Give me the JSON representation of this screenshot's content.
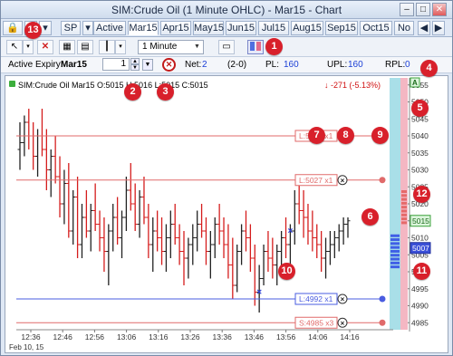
{
  "window": {
    "title": "SIM:Crude Oil (1 Minute OHLC) - Mar15 - Chart",
    "min": "–",
    "max": "□",
    "close": "✕"
  },
  "tabs": {
    "items": [
      {
        "label": "SP",
        "selected": false
      },
      {
        "label": "Active",
        "selected": false
      },
      {
        "label": "Mar15",
        "selected": true
      },
      {
        "label": "Apr15",
        "selected": false
      },
      {
        "label": "May15",
        "selected": false
      },
      {
        "label": "Jun15",
        "selected": false
      },
      {
        "label": "Jul15",
        "selected": false
      },
      {
        "label": "Aug15",
        "selected": false
      },
      {
        "label": "Sep15",
        "selected": false
      },
      {
        "label": "Oct15",
        "selected": false
      },
      {
        "label": "No",
        "selected": false
      }
    ]
  },
  "toolbar": {
    "interval": "1 Minute"
  },
  "info": {
    "expiry_label": "Active Expiry:",
    "expiry_value": "Mar15",
    "qty": "1",
    "net_label": "Net:",
    "net_value": "2",
    "pos_value": "(2-0)",
    "pl_label": "PL:",
    "pl_value": "160",
    "upl_label": "UPL:",
    "upl_value": "160",
    "rpl_label": "RPL:",
    "rpl_value": "0"
  },
  "chart_header": {
    "text": "SIM:Crude Oil Mar15 O:5015 H:5016 L:5015 C:5015",
    "change": "-271 (-5.13%)"
  },
  "chart_data": {
    "type": "bar",
    "title": "SIM:Crude Oil Mar15",
    "x_ticks": [
      "12:36",
      "12:46",
      "12:56",
      "13:06",
      "13:16",
      "13:26",
      "13:36",
      "13:46",
      "13:56",
      "14:06",
      "14:16"
    ],
    "x_start_label": "Feb 10, 15",
    "y_ticks": [
      4985,
      4990,
      4995,
      5000,
      5005,
      5010,
      5015,
      5020,
      5025,
      5030,
      5035,
      5040,
      5045,
      5050,
      5055
    ],
    "ylim": [
      4984,
      5056
    ],
    "current_price": 5015,
    "ask_tag": 5015,
    "bid_tag": 5007,
    "bars_ohlc": [
      [
        5036,
        5044,
        5030,
        5038
      ],
      [
        5038,
        5046,
        5034,
        5044
      ],
      [
        5044,
        5048,
        5036,
        5040
      ],
      [
        5040,
        5044,
        5030,
        5034
      ],
      [
        5034,
        5042,
        5028,
        5040
      ],
      [
        5040,
        5048,
        5034,
        5036
      ],
      [
        5036,
        5042,
        5024,
        5030
      ],
      [
        5030,
        5036,
        5022,
        5034
      ],
      [
        5034,
        5040,
        5026,
        5028
      ],
      [
        5028,
        5034,
        5016,
        5020
      ],
      [
        5020,
        5030,
        5014,
        5026
      ],
      [
        5026,
        5032,
        5010,
        5012
      ],
      [
        5012,
        5024,
        5008,
        5022
      ],
      [
        5022,
        5028,
        5004,
        5008
      ],
      [
        5008,
        5020,
        5004,
        5016
      ],
      [
        5016,
        5024,
        5010,
        5012
      ],
      [
        5012,
        5020,
        5006,
        5018
      ],
      [
        5018,
        5026,
        5012,
        5014
      ],
      [
        5014,
        5018,
        5006,
        5010
      ],
      [
        5010,
        5016,
        5000,
        5006
      ],
      [
        5006,
        5014,
        4996,
        5012
      ],
      [
        5012,
        5020,
        5006,
        5016
      ],
      [
        5016,
        5022,
        5008,
        5010
      ],
      [
        5010,
        5018,
        5004,
        5016
      ],
      [
        5016,
        5028,
        5012,
        5024
      ],
      [
        5024,
        5032,
        5018,
        5020
      ],
      [
        5020,
        5026,
        5012,
        5014
      ],
      [
        5014,
        5024,
        5010,
        5022
      ],
      [
        5022,
        5028,
        5014,
        5016
      ],
      [
        5016,
        5020,
        5004,
        5008
      ],
      [
        5008,
        5016,
        5000,
        5012
      ],
      [
        5012,
        5018,
        5006,
        5010
      ],
      [
        5010,
        5016,
        5002,
        5006
      ],
      [
        5006,
        5014,
        5000,
        5010
      ],
      [
        5010,
        5018,
        5004,
        5014
      ],
      [
        5014,
        5020,
        5008,
        5010
      ],
      [
        5010,
        5014,
        5002,
        5006
      ],
      [
        5006,
        5012,
        4996,
        5004
      ],
      [
        5004,
        5010,
        4998,
        5008
      ],
      [
        5008,
        5014,
        5002,
        5010
      ],
      [
        5010,
        5018,
        5006,
        5014
      ],
      [
        5014,
        5020,
        5010,
        5012
      ],
      [
        5012,
        5016,
        5002,
        5006
      ],
      [
        5006,
        5012,
        4998,
        5008
      ],
      [
        5008,
        5016,
        5004,
        5014
      ],
      [
        5014,
        5020,
        5008,
        5012
      ],
      [
        5012,
        5016,
        5004,
        5008
      ],
      [
        5008,
        5014,
        4998,
        5002
      ],
      [
        5002,
        5010,
        4992,
        4996
      ],
      [
        4996,
        5008,
        4994,
        5006
      ],
      [
        5006,
        5014,
        5002,
        5012
      ],
      [
        5012,
        5018,
        5006,
        5010
      ],
      [
        5010,
        5014,
        5000,
        5004
      ],
      [
        5004,
        5008,
        4990,
        4994
      ],
      [
        4994,
        5002,
        4988,
        4998
      ],
      [
        4998,
        5008,
        4996,
        5006
      ],
      [
        5006,
        5012,
        5000,
        5004
      ],
      [
        5004,
        5010,
        4998,
        5002
      ],
      [
        5002,
        5008,
        4996,
        5006
      ],
      [
        5006,
        5012,
        5002,
        5010
      ],
      [
        5010,
        5016,
        5004,
        5008
      ],
      [
        5008,
        5014,
        5002,
        5012
      ],
      [
        5012,
        5024,
        5008,
        5020
      ],
      [
        5020,
        5026,
        5014,
        5018
      ],
      [
        5018,
        5024,
        5010,
        5016
      ],
      [
        5016,
        5020,
        5008,
        5012
      ],
      [
        5012,
        5018,
        5006,
        5010
      ],
      [
        5010,
        5014,
        5004,
        5008
      ],
      [
        5008,
        5012,
        5000,
        5004
      ],
      [
        5004,
        5010,
        4998,
        5006
      ],
      [
        5006,
        5012,
        5002,
        5008
      ],
      [
        5008,
        5012,
        5004,
        5010
      ],
      [
        5010,
        5014,
        5006,
        5012
      ],
      [
        5012,
        5016,
        5008,
        5014
      ],
      [
        5014,
        5016,
        5010,
        5015
      ]
    ],
    "orders": [
      {
        "label": "L:5040 x1",
        "price": 5040,
        "side": "buy"
      },
      {
        "label": "L:5027 x1",
        "price": 5027,
        "side": "buy"
      },
      {
        "label": "L:4992 x1",
        "price": 4992,
        "side": "sell"
      },
      {
        "label": "S:4985 x3",
        "price": 4985,
        "side": "stop"
      }
    ],
    "fills": [
      {
        "bar": 61,
        "price": 5012,
        "marker": "x"
      },
      {
        "bar": 54,
        "price": 4994,
        "marker": "x"
      }
    ],
    "badges": [
      "1",
      "2",
      "3",
      "4",
      "5",
      "6",
      "7",
      "8",
      "9",
      "10",
      "11",
      "12",
      "13"
    ]
  }
}
